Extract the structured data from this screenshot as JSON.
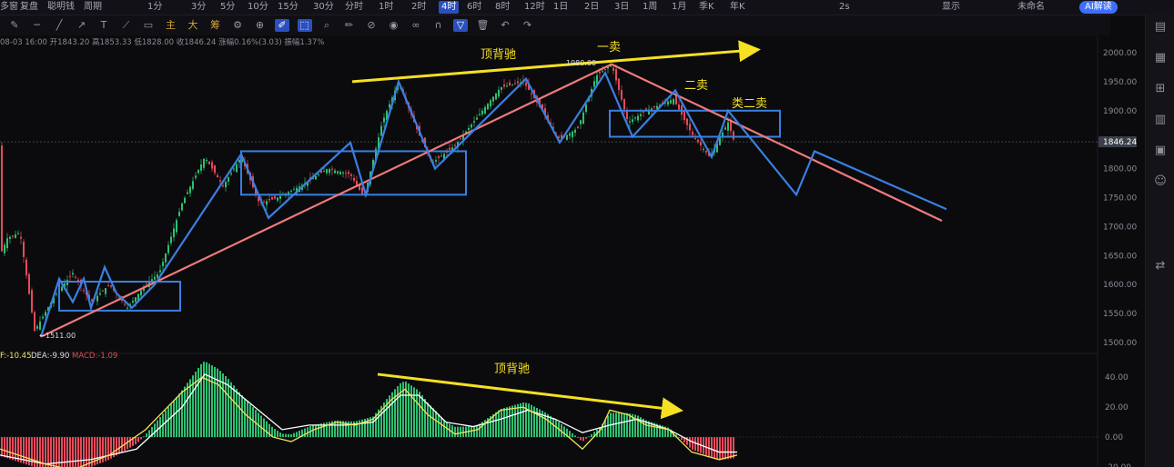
{
  "topbar": {
    "left_items": [
      "多窗",
      "复盘",
      "聪明钱",
      "周期",
      "1分",
      "3分",
      "5分",
      "10分",
      "15分",
      "30分",
      "分时",
      "1时",
      "2时",
      "4时",
      "6时",
      "8时",
      "12时",
      "1日",
      "2日",
      "3日",
      "1周",
      "1月",
      "季K",
      "年K"
    ],
    "active_period": "4时",
    "right_items": [
      "2s",
      "显示",
      "未命名",
      "AI解读"
    ]
  },
  "toolbar": {
    "icons": [
      "draw-toggle-icon",
      "minus-icon",
      "slash-icon",
      "arrow-icon",
      "text-icon",
      "ray-icon",
      "rectangle-icon",
      "main-label",
      "big-label",
      "chip-label",
      "gear-icon",
      "crosshair-icon",
      "brush-icon",
      "cursor-icon",
      "zoom-icon",
      "pencil-icon",
      "ruler-icon",
      "eye-icon",
      "link-icon",
      "magnet-icon",
      "filter-icon",
      "trash-icon",
      "undo-icon",
      "redo-icon"
    ],
    "labels": {
      "main": "主",
      "big": "大",
      "chip": "筹"
    }
  },
  "infoline": {
    "date": "08-03 16:00",
    "open_label": "开",
    "open": "1843.20",
    "high_label": "高",
    "high": "1853.33",
    "low_label": "低",
    "low": "1828.00",
    "close_label": "收",
    "close": "1846.24",
    "change_label": "涨幅",
    "change": "0.16%(3.03)",
    "amp_label": "振幅",
    "amp": "1.37%"
  },
  "macd_header": {
    "dif": "F:-10.45",
    "dea": "DEA:-9.90",
    "macd": "MACD:-1.09"
  },
  "colors": {
    "up": "#2fbf71",
    "down": "#e64a5a",
    "blue_line": "#3a7fe0",
    "trend_line": "#f07a7a",
    "arrow": "#f5e023",
    "dif": "#f2e35a",
    "dea": "#ffffff",
    "bg": "#0b0b0e"
  },
  "chart_data": [
    {
      "type": "candlestick",
      "ylim": [
        1500,
        2000
      ],
      "y_ticks": [
        "2000.00",
        "1950.00",
        "1900.00",
        "1850.00",
        "1800.00",
        "1750.00",
        "1700.00",
        "1650.00",
        "1600.00",
        "1550.00",
        "1500.00"
      ],
      "last_price": "1846.24",
      "low_marker": "1511.00",
      "high_marker": "1980.00",
      "annotations": [
        "顶背驰",
        "一卖",
        "二卖",
        "类二卖"
      ],
      "price_path": [
        [
          0,
          1650
        ],
        [
          8,
          1680
        ],
        [
          22,
          1690
        ],
        [
          38,
          1520
        ],
        [
          60,
          1580
        ],
        [
          80,
          1620
        ],
        [
          100,
          1570
        ],
        [
          120,
          1600
        ],
        [
          140,
          1560
        ],
        [
          160,
          1600
        ],
        [
          175,
          1620
        ],
        [
          200,
          1740
        ],
        [
          225,
          1820
        ],
        [
          245,
          1770
        ],
        [
          265,
          1820
        ],
        [
          285,
          1740
        ],
        [
          305,
          1750
        ],
        [
          330,
          1770
        ],
        [
          360,
          1800
        ],
        [
          385,
          1790
        ],
        [
          400,
          1750
        ],
        [
          420,
          1880
        ],
        [
          438,
          1950
        ],
        [
          460,
          1860
        ],
        [
          475,
          1810
        ],
        [
          500,
          1840
        ],
        [
          520,
          1880
        ],
        [
          550,
          1940
        ],
        [
          575,
          1950
        ],
        [
          600,
          1890
        ],
        [
          615,
          1850
        ],
        [
          635,
          1870
        ],
        [
          655,
          1960
        ],
        [
          672,
          1980
        ],
        [
          690,
          1880
        ],
        [
          710,
          1900
        ],
        [
          740,
          1920
        ],
        [
          760,
          1860
        ],
        [
          780,
          1820
        ],
        [
          800,
          1880
        ],
        [
          808,
          1840
        ]
      ],
      "blue_stroke": [
        [
          45,
          1510
        ],
        [
          65,
          1610
        ],
        [
          80,
          1570
        ],
        [
          92,
          1610
        ],
        [
          100,
          1560
        ],
        [
          115,
          1630
        ],
        [
          128,
          1585
        ],
        [
          145,
          1560
        ],
        [
          170,
          1600
        ],
        [
          265,
          1825
        ],
        [
          295,
          1715
        ],
        [
          385,
          1845
        ],
        [
          402,
          1755
        ],
        [
          438,
          1950
        ],
        [
          478,
          1800
        ],
        [
          578,
          1955
        ],
        [
          615,
          1845
        ],
        [
          665,
          1965
        ],
        [
          695,
          1855
        ],
        [
          742,
          1935
        ],
        [
          782,
          1820
        ],
        [
          800,
          1900
        ],
        [
          875,
          1755
        ],
        [
          895,
          1830
        ],
        [
          1040,
          1730
        ]
      ],
      "red_trend": [
        [
          45,
          1510
        ],
        [
          672,
          1980
        ],
        [
          1035,
          1710
        ]
      ],
      "zhongshu_boxes": [
        {
          "x": [
            65,
            198
          ],
          "y": [
            1555,
            1605
          ]
        },
        {
          "x": [
            265,
            512
          ],
          "y": [
            1755,
            1830
          ]
        },
        {
          "x": [
            670,
            857
          ],
          "y": [
            1855,
            1900
          ]
        }
      ],
      "arrows": [
        {
          "from": [
            387,
            1950
          ],
          "to": [
            830,
            2005
          ]
        }
      ]
    },
    {
      "type": "macd",
      "ylim": [
        -20,
        45
      ],
      "y_ticks": [
        "40.00",
        "20.00",
        "0.00",
        "-20.00"
      ],
      "dif_path": [
        [
          0,
          -8
        ],
        [
          50,
          -18
        ],
        [
          80,
          -22
        ],
        [
          120,
          -12
        ],
        [
          160,
          5
        ],
        [
          200,
          30
        ],
        [
          222,
          40
        ],
        [
          240,
          35
        ],
        [
          270,
          15
        ],
        [
          300,
          0
        ],
        [
          320,
          -3
        ],
        [
          345,
          5
        ],
        [
          370,
          10
        ],
        [
          390,
          8
        ],
        [
          410,
          12
        ],
        [
          430,
          25
        ],
        [
          445,
          32
        ],
        [
          470,
          15
        ],
        [
          500,
          2
        ],
        [
          525,
          5
        ],
        [
          550,
          18
        ],
        [
          575,
          20
        ],
        [
          600,
          12
        ],
        [
          625,
          0
        ],
        [
          640,
          -8
        ],
        [
          660,
          5
        ],
        [
          670,
          18
        ],
        [
          690,
          15
        ],
        [
          710,
          8
        ],
        [
          735,
          5
        ],
        [
          760,
          -10
        ],
        [
          790,
          -15
        ],
        [
          810,
          -12
        ]
      ],
      "dea_path": [
        [
          0,
          -12
        ],
        [
          50,
          -18
        ],
        [
          100,
          -15
        ],
        [
          150,
          -8
        ],
        [
          200,
          20
        ],
        [
          225,
          42
        ],
        [
          250,
          35
        ],
        [
          280,
          20
        ],
        [
          310,
          5
        ],
        [
          340,
          8
        ],
        [
          380,
          8
        ],
        [
          410,
          10
        ],
        [
          440,
          28
        ],
        [
          460,
          28
        ],
        [
          490,
          10
        ],
        [
          520,
          7
        ],
        [
          550,
          12
        ],
        [
          580,
          18
        ],
        [
          610,
          12
        ],
        [
          640,
          3
        ],
        [
          670,
          8
        ],
        [
          700,
          12
        ],
        [
          735,
          5
        ],
        [
          760,
          -3
        ],
        [
          790,
          -10
        ],
        [
          810,
          -10
        ]
      ],
      "arrows": [
        {
          "from": [
            415,
            42
          ],
          "to": [
            745,
            18
          ]
        }
      ],
      "annotation": "顶背驰"
    }
  ]
}
